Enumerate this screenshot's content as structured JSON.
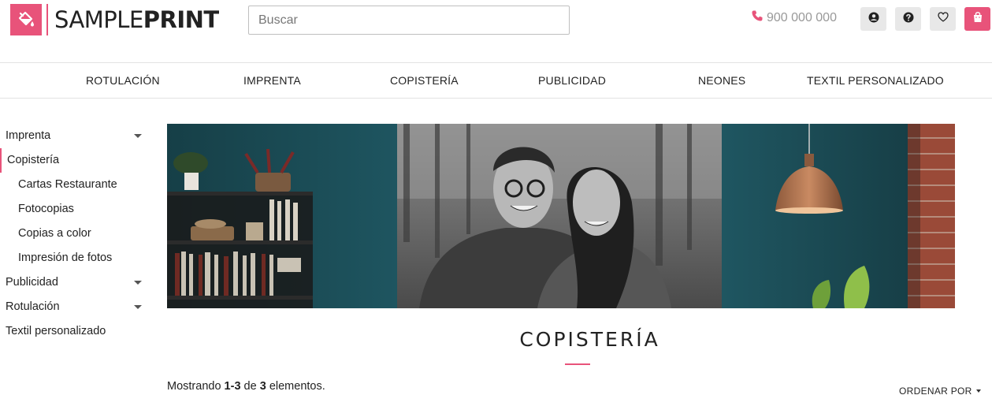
{
  "header": {
    "brand_light": "SAMPLE",
    "brand_bold": "PRINT",
    "search_placeholder": "Buscar",
    "phone": "900 000 000",
    "icons": [
      "user-icon",
      "help-icon",
      "heart-icon",
      "cart-icon"
    ],
    "accent": "#e8537a"
  },
  "nav": {
    "items": [
      "ROTULACIÓN",
      "IMPRENTA",
      "COPISTERÍA",
      "PUBLICIDAD",
      "NEONES",
      "TEXTIL PERSONALIZADO"
    ]
  },
  "sidebar": {
    "items": [
      {
        "label": "Imprenta",
        "expandable": true
      },
      {
        "label": "Copistería",
        "active": true
      },
      {
        "label": "Cartas Restaurante",
        "sub": true
      },
      {
        "label": "Fotocopias",
        "sub": true
      },
      {
        "label": "Copias a color",
        "sub": true
      },
      {
        "label": "Impresión de fotos",
        "sub": true
      },
      {
        "label": "Publicidad",
        "expandable": true
      },
      {
        "label": "Rotulación",
        "expandable": true
      },
      {
        "label": "Textil personalizado"
      }
    ]
  },
  "main": {
    "title": "COPISTERÍA",
    "showing_prefix": "Mostrando",
    "showing_range": "1-3",
    "showing_of": "de",
    "showing_total": "3",
    "showing_suffix": "elementos.",
    "sort_label": "ORDENAR POR"
  }
}
